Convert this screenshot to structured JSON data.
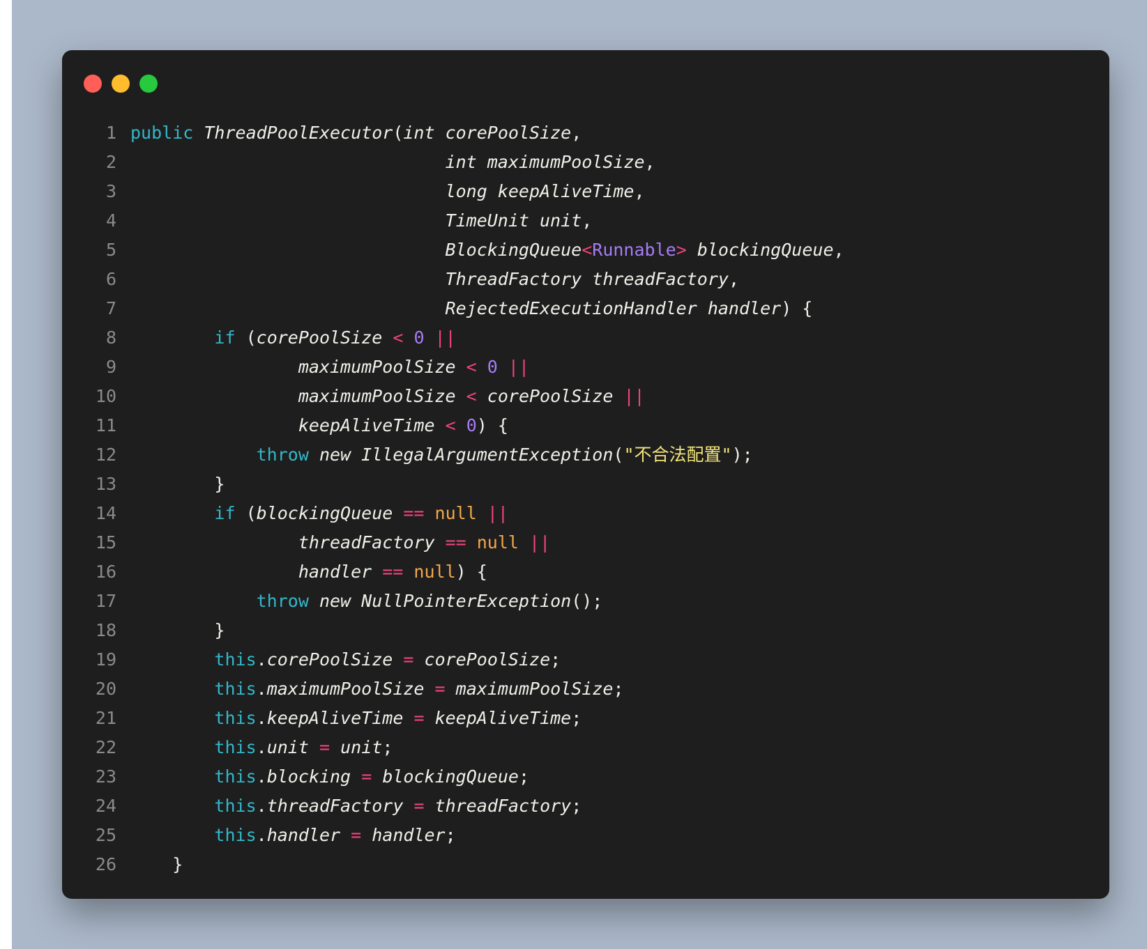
{
  "window": {
    "controls": [
      "close",
      "minimize",
      "maximize"
    ],
    "control_colors": {
      "close": "#ff5f56",
      "minimize": "#ffbd2e",
      "maximize": "#27c93f"
    }
  },
  "code": {
    "language": "java",
    "colors": {
      "background": "#1e1e1e",
      "keyword": "#33b7c9",
      "operator": "#f0447b",
      "number": "#a77cf6",
      "null": "#f3a84b",
      "string": "#f3e47a",
      "line_number": "#8b8b8b"
    },
    "lines": [
      {
        "n": "1",
        "tokens": [
          {
            "t": "public",
            "c": "kw"
          },
          {
            "t": " ",
            "c": "pl"
          },
          {
            "t": "ThreadPoolExecutor",
            "c": "it"
          },
          {
            "t": "(",
            "c": "pl"
          },
          {
            "t": "int corePoolSize",
            "c": "it"
          },
          {
            "t": ",",
            "c": "pl"
          }
        ]
      },
      {
        "n": "2",
        "tokens": [
          {
            "t": "                              ",
            "c": "pl"
          },
          {
            "t": "int maximumPoolSize",
            "c": "it"
          },
          {
            "t": ",",
            "c": "pl"
          }
        ]
      },
      {
        "n": "3",
        "tokens": [
          {
            "t": "                              ",
            "c": "pl"
          },
          {
            "t": "long keepAliveTime",
            "c": "it"
          },
          {
            "t": ",",
            "c": "pl"
          }
        ]
      },
      {
        "n": "4",
        "tokens": [
          {
            "t": "                              ",
            "c": "pl"
          },
          {
            "t": "TimeUnit unit",
            "c": "it"
          },
          {
            "t": ",",
            "c": "pl"
          }
        ]
      },
      {
        "n": "5",
        "tokens": [
          {
            "t": "                              ",
            "c": "pl"
          },
          {
            "t": "BlockingQueue",
            "c": "it"
          },
          {
            "t": "<",
            "c": "op"
          },
          {
            "t": "Runnable",
            "c": "gen"
          },
          {
            "t": ">",
            "c": "op"
          },
          {
            "t": " ",
            "c": "pl"
          },
          {
            "t": "blockingQueue",
            "c": "it"
          },
          {
            "t": ",",
            "c": "pl"
          }
        ]
      },
      {
        "n": "6",
        "tokens": [
          {
            "t": "                              ",
            "c": "pl"
          },
          {
            "t": "ThreadFactory threadFactory",
            "c": "it"
          },
          {
            "t": ",",
            "c": "pl"
          }
        ]
      },
      {
        "n": "7",
        "tokens": [
          {
            "t": "                              ",
            "c": "pl"
          },
          {
            "t": "RejectedExecutionHandler handler",
            "c": "it"
          },
          {
            "t": ") {",
            "c": "pl"
          }
        ]
      },
      {
        "n": "8",
        "tokens": [
          {
            "t": "        ",
            "c": "pl"
          },
          {
            "t": "if",
            "c": "kw"
          },
          {
            "t": " (",
            "c": "pl"
          },
          {
            "t": "corePoolSize",
            "c": "it"
          },
          {
            "t": " ",
            "c": "pl"
          },
          {
            "t": "<",
            "c": "op"
          },
          {
            "t": " ",
            "c": "pl"
          },
          {
            "t": "0",
            "c": "num"
          },
          {
            "t": " ",
            "c": "pl"
          },
          {
            "t": "||",
            "c": "op"
          }
        ]
      },
      {
        "n": "9",
        "tokens": [
          {
            "t": "                ",
            "c": "pl"
          },
          {
            "t": "maximumPoolSize",
            "c": "it"
          },
          {
            "t": " ",
            "c": "pl"
          },
          {
            "t": "<",
            "c": "op"
          },
          {
            "t": " ",
            "c": "pl"
          },
          {
            "t": "0",
            "c": "num"
          },
          {
            "t": " ",
            "c": "pl"
          },
          {
            "t": "||",
            "c": "op"
          }
        ]
      },
      {
        "n": "10",
        "tokens": [
          {
            "t": "                ",
            "c": "pl"
          },
          {
            "t": "maximumPoolSize",
            "c": "it"
          },
          {
            "t": " ",
            "c": "pl"
          },
          {
            "t": "<",
            "c": "op"
          },
          {
            "t": " ",
            "c": "pl"
          },
          {
            "t": "corePoolSize",
            "c": "it"
          },
          {
            "t": " ",
            "c": "pl"
          },
          {
            "t": "||",
            "c": "op"
          }
        ]
      },
      {
        "n": "11",
        "tokens": [
          {
            "t": "                ",
            "c": "pl"
          },
          {
            "t": "keepAliveTime",
            "c": "it"
          },
          {
            "t": " ",
            "c": "pl"
          },
          {
            "t": "<",
            "c": "op"
          },
          {
            "t": " ",
            "c": "pl"
          },
          {
            "t": "0",
            "c": "num"
          },
          {
            "t": ") {",
            "c": "pl"
          }
        ]
      },
      {
        "n": "12",
        "tokens": [
          {
            "t": "            ",
            "c": "pl"
          },
          {
            "t": "throw",
            "c": "kw"
          },
          {
            "t": " ",
            "c": "pl"
          },
          {
            "t": "new IllegalArgumentException",
            "c": "it"
          },
          {
            "t": "(",
            "c": "pl"
          },
          {
            "t": "\"不合法配置\"",
            "c": "str"
          },
          {
            "t": ");",
            "c": "pl"
          }
        ]
      },
      {
        "n": "13",
        "tokens": [
          {
            "t": "        }",
            "c": "pl"
          }
        ]
      },
      {
        "n": "14",
        "tokens": [
          {
            "t": "        ",
            "c": "pl"
          },
          {
            "t": "if",
            "c": "kw"
          },
          {
            "t": " (",
            "c": "pl"
          },
          {
            "t": "blockingQueue",
            "c": "it"
          },
          {
            "t": " ",
            "c": "pl"
          },
          {
            "t": "==",
            "c": "op"
          },
          {
            "t": " ",
            "c": "pl"
          },
          {
            "t": "null",
            "c": "nul"
          },
          {
            "t": " ",
            "c": "pl"
          },
          {
            "t": "||",
            "c": "op"
          }
        ]
      },
      {
        "n": "15",
        "tokens": [
          {
            "t": "                ",
            "c": "pl"
          },
          {
            "t": "threadFactory",
            "c": "it"
          },
          {
            "t": " ",
            "c": "pl"
          },
          {
            "t": "==",
            "c": "op"
          },
          {
            "t": " ",
            "c": "pl"
          },
          {
            "t": "null",
            "c": "nul"
          },
          {
            "t": " ",
            "c": "pl"
          },
          {
            "t": "||",
            "c": "op"
          }
        ]
      },
      {
        "n": "16",
        "tokens": [
          {
            "t": "                ",
            "c": "pl"
          },
          {
            "t": "handler",
            "c": "it"
          },
          {
            "t": " ",
            "c": "pl"
          },
          {
            "t": "==",
            "c": "op"
          },
          {
            "t": " ",
            "c": "pl"
          },
          {
            "t": "null",
            "c": "nul"
          },
          {
            "t": ") {",
            "c": "pl"
          }
        ]
      },
      {
        "n": "17",
        "tokens": [
          {
            "t": "            ",
            "c": "pl"
          },
          {
            "t": "throw",
            "c": "kw"
          },
          {
            "t": " ",
            "c": "pl"
          },
          {
            "t": "new NullPointerException",
            "c": "it"
          },
          {
            "t": "();",
            "c": "pl"
          }
        ]
      },
      {
        "n": "18",
        "tokens": [
          {
            "t": "        }",
            "c": "pl"
          }
        ]
      },
      {
        "n": "19",
        "tokens": [
          {
            "t": "        ",
            "c": "pl"
          },
          {
            "t": "this",
            "c": "kw"
          },
          {
            "t": ".",
            "c": "pl"
          },
          {
            "t": "corePoolSize",
            "c": "it"
          },
          {
            "t": " ",
            "c": "pl"
          },
          {
            "t": "=",
            "c": "op"
          },
          {
            "t": " ",
            "c": "pl"
          },
          {
            "t": "corePoolSize",
            "c": "it"
          },
          {
            "t": ";",
            "c": "pl"
          }
        ]
      },
      {
        "n": "20",
        "tokens": [
          {
            "t": "        ",
            "c": "pl"
          },
          {
            "t": "this",
            "c": "kw"
          },
          {
            "t": ".",
            "c": "pl"
          },
          {
            "t": "maximumPoolSize",
            "c": "it"
          },
          {
            "t": " ",
            "c": "pl"
          },
          {
            "t": "=",
            "c": "op"
          },
          {
            "t": " ",
            "c": "pl"
          },
          {
            "t": "maximumPoolSize",
            "c": "it"
          },
          {
            "t": ";",
            "c": "pl"
          }
        ]
      },
      {
        "n": "21",
        "tokens": [
          {
            "t": "        ",
            "c": "pl"
          },
          {
            "t": "this",
            "c": "kw"
          },
          {
            "t": ".",
            "c": "pl"
          },
          {
            "t": "keepAliveTime",
            "c": "it"
          },
          {
            "t": " ",
            "c": "pl"
          },
          {
            "t": "=",
            "c": "op"
          },
          {
            "t": " ",
            "c": "pl"
          },
          {
            "t": "keepAliveTime",
            "c": "it"
          },
          {
            "t": ";",
            "c": "pl"
          }
        ]
      },
      {
        "n": "22",
        "tokens": [
          {
            "t": "        ",
            "c": "pl"
          },
          {
            "t": "this",
            "c": "kw"
          },
          {
            "t": ".",
            "c": "pl"
          },
          {
            "t": "unit",
            "c": "it"
          },
          {
            "t": " ",
            "c": "pl"
          },
          {
            "t": "=",
            "c": "op"
          },
          {
            "t": " ",
            "c": "pl"
          },
          {
            "t": "unit",
            "c": "it"
          },
          {
            "t": ";",
            "c": "pl"
          }
        ]
      },
      {
        "n": "23",
        "tokens": [
          {
            "t": "        ",
            "c": "pl"
          },
          {
            "t": "this",
            "c": "kw"
          },
          {
            "t": ".",
            "c": "pl"
          },
          {
            "t": "blocking",
            "c": "it"
          },
          {
            "t": " ",
            "c": "pl"
          },
          {
            "t": "=",
            "c": "op"
          },
          {
            "t": " ",
            "c": "pl"
          },
          {
            "t": "blockingQueue",
            "c": "it"
          },
          {
            "t": ";",
            "c": "pl"
          }
        ]
      },
      {
        "n": "24",
        "tokens": [
          {
            "t": "        ",
            "c": "pl"
          },
          {
            "t": "this",
            "c": "kw"
          },
          {
            "t": ".",
            "c": "pl"
          },
          {
            "t": "threadFactory",
            "c": "it"
          },
          {
            "t": " ",
            "c": "pl"
          },
          {
            "t": "=",
            "c": "op"
          },
          {
            "t": " ",
            "c": "pl"
          },
          {
            "t": "threadFactory",
            "c": "it"
          },
          {
            "t": ";",
            "c": "pl"
          }
        ]
      },
      {
        "n": "25",
        "tokens": [
          {
            "t": "        ",
            "c": "pl"
          },
          {
            "t": "this",
            "c": "kw"
          },
          {
            "t": ".",
            "c": "pl"
          },
          {
            "t": "handler",
            "c": "it"
          },
          {
            "t": " ",
            "c": "pl"
          },
          {
            "t": "=",
            "c": "op"
          },
          {
            "t": " ",
            "c": "pl"
          },
          {
            "t": "handler",
            "c": "it"
          },
          {
            "t": ";",
            "c": "pl"
          }
        ]
      },
      {
        "n": "26",
        "tokens": [
          {
            "t": "    }",
            "c": "pl"
          }
        ]
      }
    ]
  }
}
